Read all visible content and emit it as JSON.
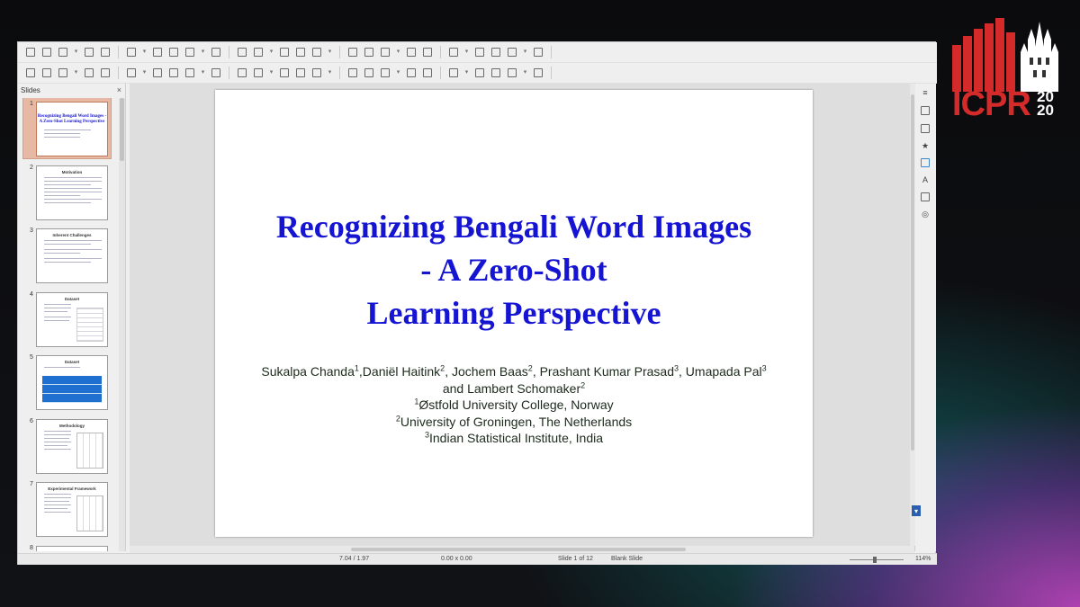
{
  "logo": {
    "text": "ICPR",
    "year_top": "20",
    "year_bottom": "20",
    "brand_color": "#d42a2a"
  },
  "window": {
    "toolbar1_icons": [
      "presentation-icon",
      "open-icon",
      "save-icon",
      "export-pdf-icon",
      "print-icon",
      "cut-icon",
      "copy-icon",
      "paste-icon",
      "clone-icon",
      "undo-icon",
      "redo-icon",
      "find-icon",
      "spelling-icon",
      "grid-icon",
      "table-icon",
      "image-icon",
      "chart-icon",
      "textbox-icon",
      "fontwork-icon",
      "link-icon",
      "start-slideshow-icon",
      "display-views-icon",
      "master-slide-icon",
      "comment-icon",
      "new-slide-icon"
    ],
    "toolbar2_icons": [
      "select-icon",
      "zoom-icon",
      "line-color-icon",
      "fill-color-icon",
      "line-icon",
      "rectangle-icon",
      "ellipse-icon",
      "arrow-line-icon",
      "curve-icon",
      "connector-icon",
      "basic-shapes-icon",
      "symbol-shapes-icon",
      "block-arrows-icon",
      "flowchart-icon",
      "callouts-icon",
      "stars-icon",
      "3d-objects-icon",
      "rotate-icon",
      "align-icon",
      "arrange-icon",
      "distribute-icon",
      "shadow-icon",
      "crop-icon",
      "filter-icon",
      "toggle-extrusion-icon"
    ]
  },
  "slides_panel": {
    "title": "Slides",
    "close_glyph": "×",
    "slides": [
      {
        "num": "1",
        "title": "Recognizing Bengali Word Images - A Zero-Shot Learning Perspective"
      },
      {
        "num": "2",
        "title": "Motivation"
      },
      {
        "num": "3",
        "title": "Inherent Challenges"
      },
      {
        "num": "4",
        "title": "Dataset"
      },
      {
        "num": "5",
        "title": "Dataset"
      },
      {
        "num": "6",
        "title": "Methodology"
      },
      {
        "num": "7",
        "title": "Experimental Framework"
      },
      {
        "num": "8",
        "title": ""
      }
    ]
  },
  "slide": {
    "title_line1": "Recognizing Bengali Word Images",
    "title_line2": "- A Zero-Shot",
    "title_line3": "Learning Perspective",
    "authors": [
      {
        "name": "Sukalpa Chanda",
        "sup": "1"
      },
      {
        "name": ",Daniël Haitink",
        "sup": "2"
      },
      {
        "name": ", Jochem Baas",
        "sup": "2"
      },
      {
        "name": ", Prashant Kumar Prasad",
        "sup": "3"
      },
      {
        "name": ", Umapada Pal",
        "sup": "3"
      },
      {
        "name": " and Lambert Schomaker",
        "sup": "2"
      }
    ],
    "affiliations": [
      {
        "sup": "1",
        "text": "Østfold University College, Norway"
      },
      {
        "sup": "2",
        "text": "University of Groningen, The Netherlands"
      },
      {
        "sup": "3",
        "text": "Indian Statistical Institute, India"
      }
    ],
    "title_color": "#1414d2"
  },
  "statusbar": {
    "position": "7.04 / 1.97",
    "size": "0.00 x 0.00",
    "slide_info": "Slide 1 of 12",
    "layout": "Blank Slide",
    "zoom": "114%"
  }
}
